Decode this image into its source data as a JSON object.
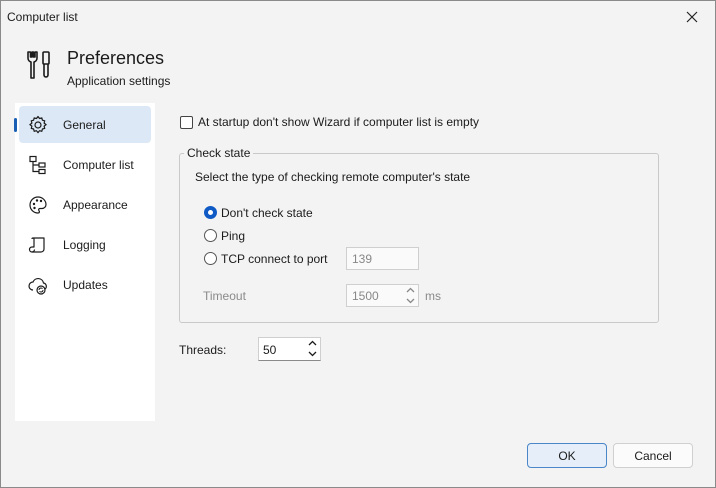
{
  "window": {
    "title": "Computer list"
  },
  "header": {
    "title": "Preferences",
    "subtitle": "Application settings"
  },
  "sidebar": {
    "items": [
      {
        "label": "General",
        "icon": "gear-icon",
        "active": true
      },
      {
        "label": "Computer list",
        "icon": "tree-icon",
        "active": false
      },
      {
        "label": "Appearance",
        "icon": "palette-icon",
        "active": false
      },
      {
        "label": "Logging",
        "icon": "scroll-icon",
        "active": false
      },
      {
        "label": "Updates",
        "icon": "cloud-update-icon",
        "active": false
      }
    ]
  },
  "general": {
    "startup_checkbox_label": "At startup don't show Wizard if computer list is empty",
    "startup_checkbox_checked": false,
    "check_state": {
      "legend": "Check state",
      "description": "Select the type  of  checking remote computer's state",
      "options": [
        {
          "label": "Don't check state",
          "selected": true
        },
        {
          "label": "Ping",
          "selected": false
        },
        {
          "label": "TCP connect to port",
          "selected": false
        }
      ],
      "port_value": "139",
      "timeout_label": "Timeout",
      "timeout_value": "1500",
      "timeout_unit": "ms"
    },
    "threads_label": "Threads:",
    "threads_value": "50"
  },
  "buttons": {
    "ok": "OK",
    "cancel": "Cancel"
  },
  "colors": {
    "accent": "#0f5ac4",
    "selected_nav_bg": "#dce8f6"
  }
}
